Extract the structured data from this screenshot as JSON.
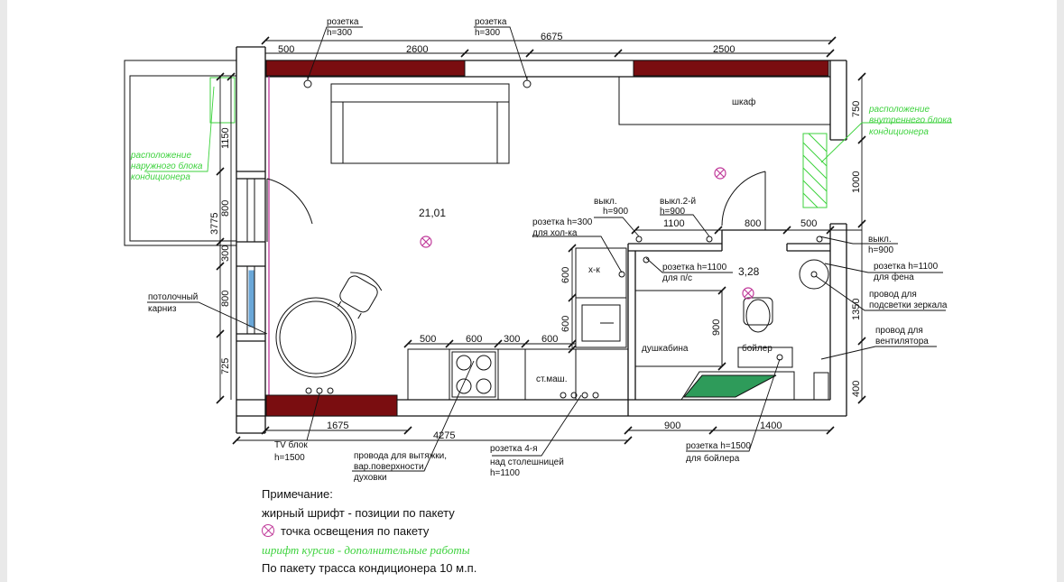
{
  "colors": {
    "wall": "#111111",
    "red_segment": "#7a0d10",
    "green": "#3dd23d",
    "magenta": "#c03a9a",
    "blue": "#6aa7d8"
  },
  "dims": {
    "top_total": "6675",
    "top_500": "500",
    "top_2600": "2600",
    "top_2500": "2500",
    "left_1150": "1150",
    "left_800": "800",
    "left_3775": "3775",
    "left_300": "300",
    "left_800b": "800",
    "left_725": "725",
    "right_750": "750",
    "right_1000": "1000",
    "right_1350": "1350",
    "right_400": "400",
    "mid_1100": "1100",
    "mid_800": "800",
    "mid_500": "500",
    "kit_500": "500",
    "kit_600a": "600",
    "kit_300": "300",
    "kit_600b": "600",
    "v600a": "600",
    "v600b": "600",
    "v900": "900",
    "bot_1675": "1675",
    "bot_4275": "4275",
    "bot_900": "900",
    "bot_1400": "1400"
  },
  "labels": {
    "socket_top1": "розетка",
    "socket_top1_h": "h=300",
    "socket_top2": "розетка",
    "socket_top2_h": "h=300",
    "wardrobe": "шкаф",
    "room_area": "21,01",
    "bath_area": "3,28",
    "switch1": "выкл.",
    "switch1_h": "h=900",
    "switch2": "выкл.2-й",
    "switch2_h": "h=900",
    "switch3": "выкл.",
    "switch3_h": "h=900",
    "socket_fridge": "розетка h=300",
    "socket_fridge2": "для хол-ка",
    "socket_dw": "розетка h=1100",
    "socket_dw2": "для п/с",
    "fridge": "х-к",
    "shower": "душкабина",
    "boiler": "бойлер",
    "washer": "ст.маш.",
    "socket_hair": "розетка h=1100",
    "socket_hair2": "для фена",
    "mirror_wire": "провод для",
    "mirror_wire2": "подсветки зеркала",
    "fan_wire": "провод для",
    "fan_wire2": "вентилятора",
    "cornice": "потолочный",
    "cornice2": "карниз",
    "tv": "TV блок",
    "tv_h": "h=1500",
    "hood1": "провода для вытяжки,",
    "hood2": "вар.поверхности,",
    "hood3": "духовки",
    "counter1": "розетка 4-я",
    "counter2": "над столешницей",
    "counter3": "h=1100",
    "boiler_sock": "розетка h=1500",
    "boiler_sock2": "для бойлера",
    "ac_ext1": "расположение",
    "ac_ext2": "наружного блока",
    "ac_ext3": "кондиционера",
    "ac_int1": "расположение",
    "ac_int2": "внутреннего блока",
    "ac_int3": "кондиционера"
  },
  "notes": {
    "title": "Примечание:",
    "bold": "жирный шрифт - позиции по пакету",
    "lamp": "точка освещения по пакету",
    "italic": "шрифт курсив - дополнительные работы",
    "ac": "По пакету трасса кондиционера 10 м.п."
  }
}
